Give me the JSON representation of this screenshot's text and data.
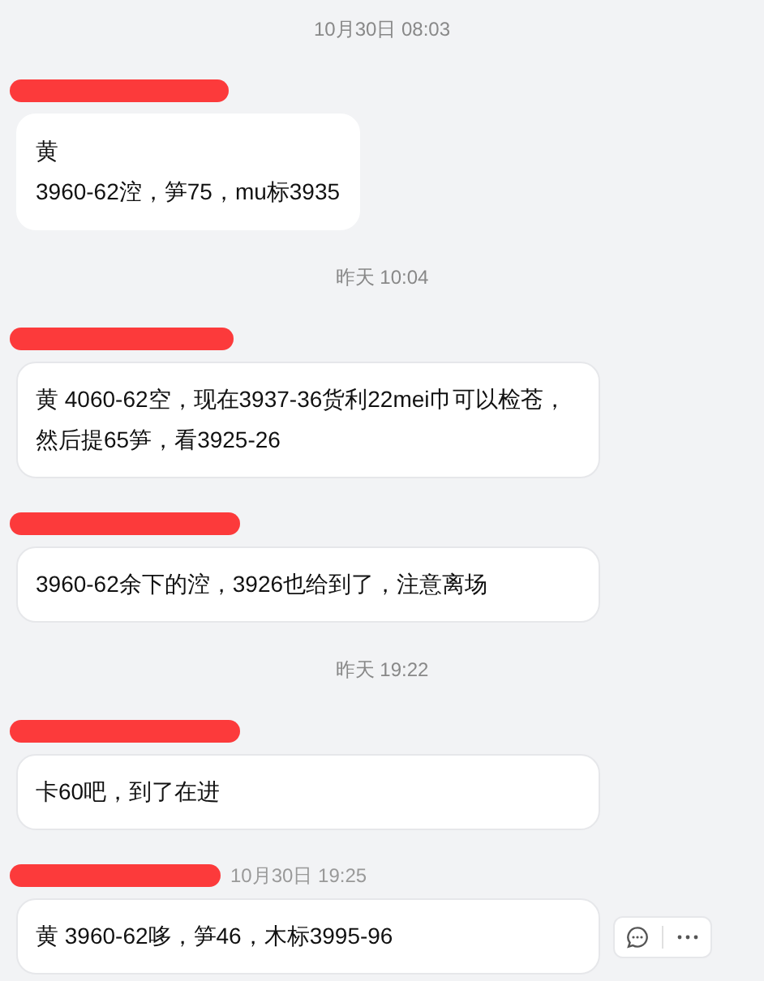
{
  "feed": [
    {
      "kind": "time",
      "text": "10月30日 08:03"
    },
    {
      "kind": "message",
      "lines": [
        "黄",
        "3960-62涳，笋75，mu标3935"
      ],
      "fit": true
    },
    {
      "kind": "time",
      "text": "昨天 10:04"
    },
    {
      "kind": "message",
      "lines": [
        "黄 4060-62空，现在3937-36货利22mei巾可以检苍，然后提65笋，看3925-26"
      ],
      "fit": false
    },
    {
      "kind": "message",
      "lines": [
        "3960-62余下的涳，3926也给到了，注意离场"
      ],
      "fit": false
    },
    {
      "kind": "time",
      "text": "昨天 19:22"
    },
    {
      "kind": "message",
      "lines": [
        "卡60吧，到了在进"
      ],
      "fit": false
    },
    {
      "kind": "message",
      "time": "10月30日 19:25",
      "lines": [
        "黄 3960-62哆，笋46，木标3995-96"
      ],
      "fit": false,
      "hovered": true
    }
  ]
}
